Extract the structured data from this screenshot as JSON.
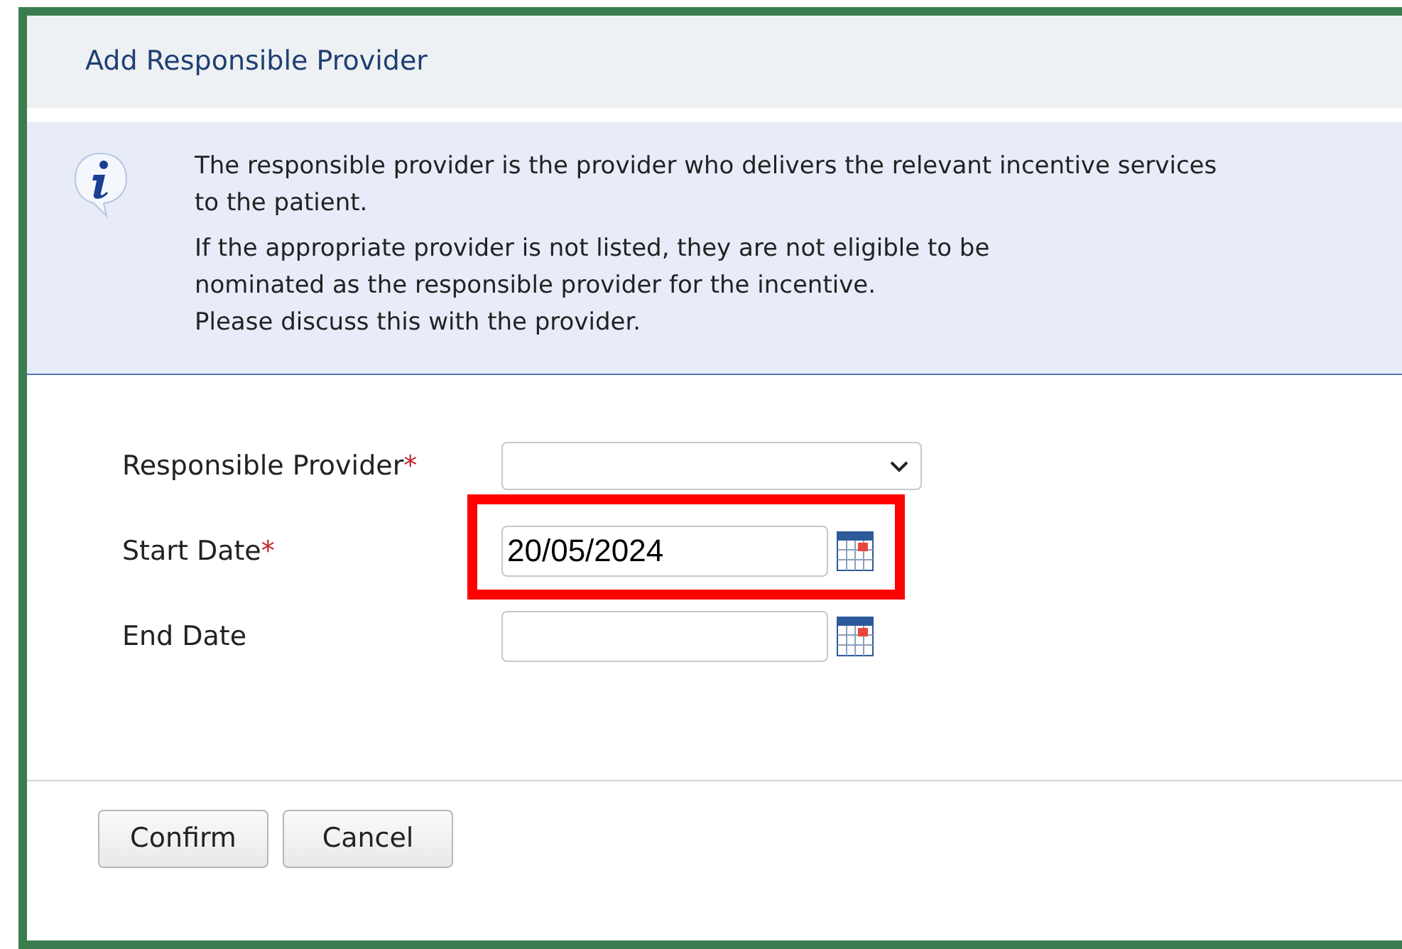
{
  "dialog": {
    "title": "Add Responsible Provider"
  },
  "info": {
    "paragraphs": [
      [
        "The responsible provider is the provider who delivers the relevant incentive services to the patient."
      ],
      [
        "If the appropriate provider is not listed, they are not eligible to be",
        "nominated as the responsible provider for the incentive.",
        "Please discuss this with the provider."
      ]
    ]
  },
  "fields": [
    {
      "label": "Responsible Provider",
      "required_mark": "*",
      "kind": "select",
      "highlighted": false
    },
    {
      "label": "Start Date",
      "required_mark": "*",
      "kind": "date",
      "value": "20/05/2024",
      "highlighted": true
    },
    {
      "label": "End Date",
      "kind": "date",
      "highlighted": false
    }
  ],
  "buttons": [
    "Confirm",
    "Cancel"
  ]
}
